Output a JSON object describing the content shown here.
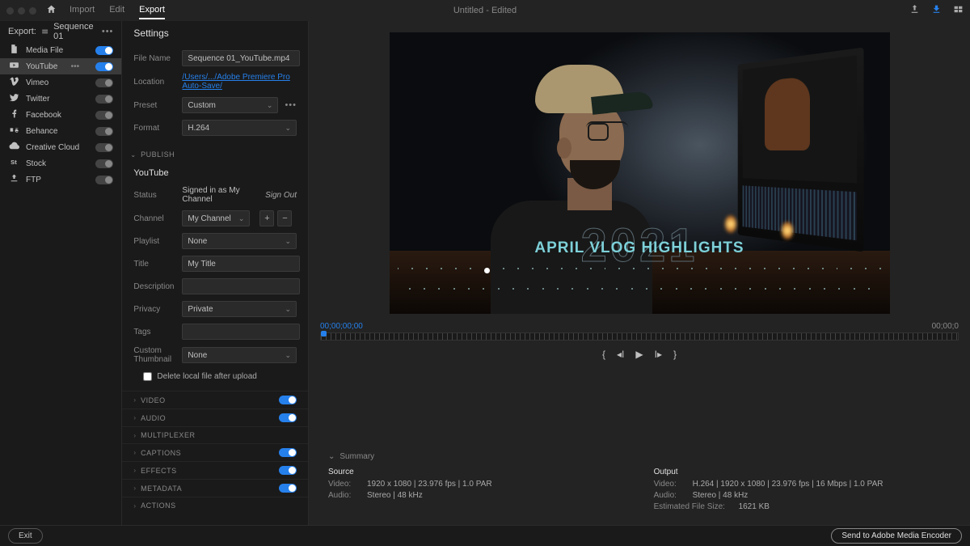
{
  "topbar": {
    "tabs": {
      "import": "Import",
      "edit": "Edit",
      "export": "Export"
    },
    "doc_title": "Untitled - Edited"
  },
  "export": {
    "header_label": "Export:",
    "sequence_name": "Sequence 01",
    "destinations": [
      {
        "icon": "file",
        "label": "Media File",
        "on": true,
        "active": false,
        "dots": false
      },
      {
        "icon": "youtube",
        "label": "YouTube",
        "on": true,
        "active": true,
        "dots": true
      },
      {
        "icon": "vimeo",
        "label": "Vimeo",
        "on": false,
        "active": false,
        "dots": false
      },
      {
        "icon": "twitter",
        "label": "Twitter",
        "on": false,
        "active": false,
        "dots": false
      },
      {
        "icon": "facebook",
        "label": "Facebook",
        "on": false,
        "active": false,
        "dots": false
      },
      {
        "icon": "behance",
        "label": "Behance",
        "on": false,
        "active": false,
        "dots": false
      },
      {
        "icon": "cc",
        "label": "Creative Cloud",
        "on": false,
        "active": false,
        "dots": false
      },
      {
        "icon": "stock",
        "label": "Stock",
        "on": false,
        "active": false,
        "dots": false
      },
      {
        "icon": "ftp",
        "label": "FTP",
        "on": false,
        "active": false,
        "dots": false
      }
    ]
  },
  "settings": {
    "title": "Settings",
    "labels": {
      "file_name": "File Name",
      "location": "Location",
      "preset": "Preset",
      "format": "Format",
      "publish": "PUBLISH",
      "youtube": "YouTube",
      "status": "Status",
      "channel": "Channel",
      "playlist": "Playlist",
      "title_lbl": "Title",
      "description": "Description",
      "privacy": "Privacy",
      "tags": "Tags",
      "thumbnail": "Custom Thumbnail",
      "delete_local": "Delete local file after upload",
      "sign_out": "Sign Out"
    },
    "values": {
      "file_name": "Sequence 01_YouTube.mp4",
      "location": "/Users/.../Adobe Premiere Pro Auto-Save/",
      "preset": "Custom",
      "format": "H.264",
      "status": "Signed in as My Channel",
      "channel": "My Channel",
      "playlist": "None",
      "title": "My Title",
      "description": "",
      "privacy": "Private",
      "tags": "",
      "thumbnail": "None"
    },
    "accordions": [
      {
        "label": "VIDEO",
        "toggle": true
      },
      {
        "label": "AUDIO",
        "toggle": true
      },
      {
        "label": "MULTIPLEXER",
        "toggle": false
      },
      {
        "label": "CAPTIONS",
        "toggle": true
      },
      {
        "label": "EFFECTS",
        "toggle": true
      },
      {
        "label": "METADATA",
        "toggle": true
      },
      {
        "label": "ACTIONS",
        "toggle": false
      }
    ]
  },
  "preview": {
    "year": "2021",
    "title": "APRIL VLOG HIGHLIGHTS",
    "tc_left": "00;00;00;00",
    "tc_right": "00;00;0"
  },
  "summary": {
    "header": "Summary",
    "source": {
      "h": "Source",
      "video_k": "Video:",
      "video_v": "1920 x 1080 | 23.976 fps | 1.0 PAR",
      "audio_k": "Audio:",
      "audio_v": "Stereo | 48 kHz"
    },
    "output": {
      "h": "Output",
      "video_k": "Video:",
      "video_v": "H.264 | 1920 x 1080 | 23.976 fps | 16 Mbps | 1.0 PAR",
      "audio_k": "Audio:",
      "audio_v": "Stereo | 48 kHz",
      "size_k": "Estimated File Size:",
      "size_v": "1621 KB"
    }
  },
  "bottom": {
    "exit": "Exit",
    "send": "Send to Adobe Media Encoder"
  }
}
